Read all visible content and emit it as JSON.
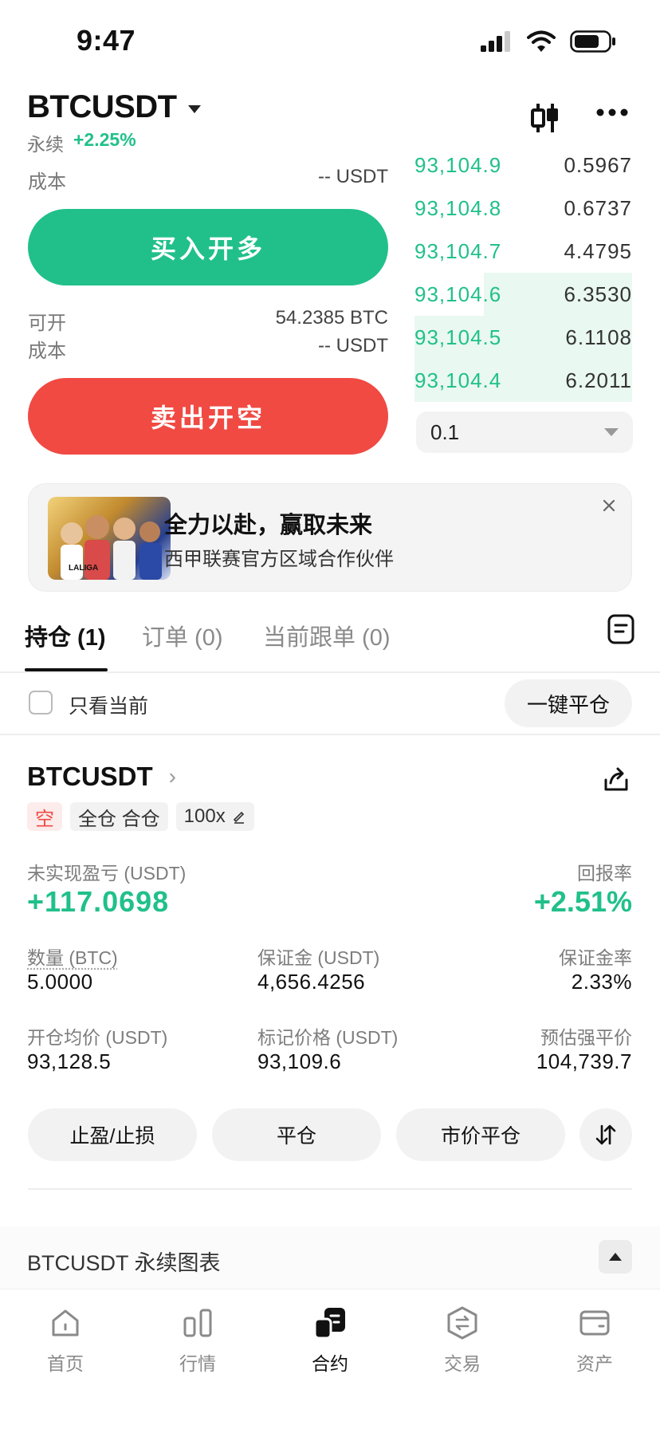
{
  "status_bar": {
    "time": "9:47"
  },
  "header": {
    "symbol": "BTCUSDT",
    "type": "永续",
    "change": "+2.25%"
  },
  "trade_panel": {
    "cost_label_top": "成本",
    "cost_value_top": "-- USDT",
    "buy_button": "买入开多",
    "available_label": "可开",
    "available_value": "54.2385 BTC",
    "cost_label": "成本",
    "cost_value": "-- USDT",
    "sell_button": "卖出开空"
  },
  "order_book": {
    "rows": [
      {
        "price": "93,104.9",
        "qty": "0.5967",
        "depth": 0.0
      },
      {
        "price": "93,104.8",
        "qty": "0.6737",
        "depth": 0.0
      },
      {
        "price": "93,104.7",
        "qty": "4.4795",
        "depth": 0.0
      },
      {
        "price": "93,104.6",
        "qty": "6.3530",
        "depth": 0.68
      },
      {
        "price": "93,104.5",
        "qty": "6.1108",
        "depth": 1.0
      },
      {
        "price": "93,104.4",
        "qty": "6.2011",
        "depth": 1.0
      }
    ],
    "precision": "0.1"
  },
  "banner": {
    "title": "全力以赴，赢取未来",
    "subtitle": "西甲联赛官方区域合作伙伴",
    "image_caption": "LALIGA"
  },
  "tabs": [
    {
      "label": "持仓 (1)"
    },
    {
      "label": "订单 (0)"
    },
    {
      "label": "当前跟单 (0)"
    }
  ],
  "filter": {
    "only_current": "只看当前",
    "close_all": "一键平仓"
  },
  "position": {
    "symbol": "BTCUSDT",
    "side": "空",
    "margin_mode": "全仓 合仓",
    "leverage": "100x",
    "pnl_label": "未实现盈亏 (USDT)",
    "pnl_value": "+117.0698",
    "roe_label": "回报率",
    "roe_value": "+2.51%",
    "qty_label": "数量 (BTC)",
    "qty_value": "5.0000",
    "margin_label": "保证金 (USDT)",
    "margin_value": "4,656.4256",
    "margin_rate_label": "保证金率",
    "margin_rate_value": "2.33%",
    "entry_label": "开仓均价 (USDT)",
    "entry_value": "93,128.5",
    "mark_label": "标记价格 (USDT)",
    "mark_value": "93,109.6",
    "liq_label": "预估强平价",
    "liq_value": "104,739.7",
    "actions": {
      "tpsl": "止盈/止损",
      "close": "平仓",
      "market_close": "市价平仓"
    }
  },
  "chart_section": {
    "label": "BTCUSDT 永续图表"
  },
  "bottom_nav": [
    {
      "label": "首页",
      "icon": "home-icon"
    },
    {
      "label": "行情",
      "icon": "market-icon"
    },
    {
      "label": "合约",
      "icon": "futures-icon"
    },
    {
      "label": "交易",
      "icon": "trade-icon"
    },
    {
      "label": "资产",
      "icon": "wallet-icon"
    }
  ],
  "colors": {
    "green": "#21c08b",
    "red": "#f04a43"
  }
}
